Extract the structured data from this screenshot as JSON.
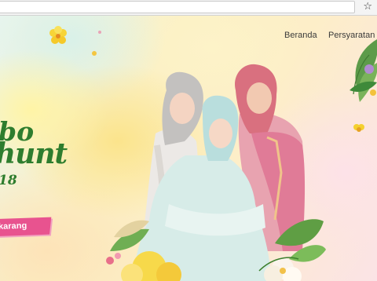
{
  "browser": {
    "bookmark_icon": "star-icon",
    "bookmark_glyph": "☆"
  },
  "nav": {
    "home": "Beranda",
    "terms": "Persyaratan"
  },
  "logo": {
    "line1": "bo",
    "line2": "hunt",
    "line3": "18"
  },
  "cta": {
    "label": "karang"
  },
  "colors": {
    "accent_pink": "#e8538f",
    "logo_green": "#2e7d2e"
  }
}
